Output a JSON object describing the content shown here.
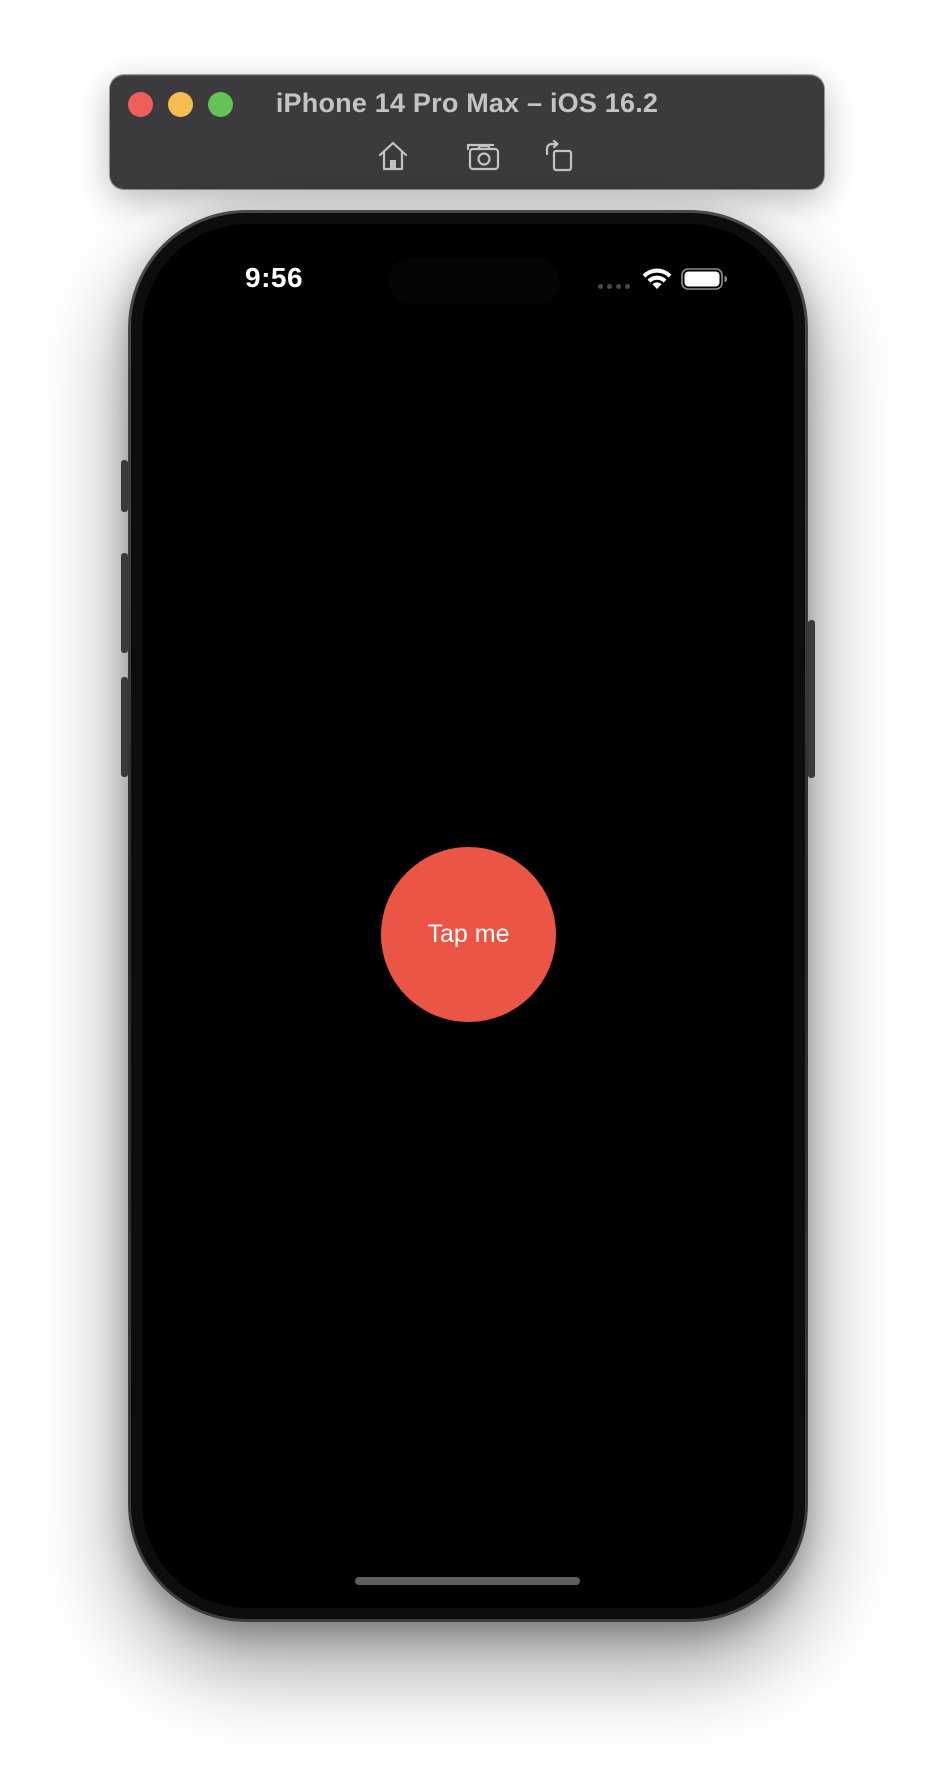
{
  "simulator": {
    "title": "iPhone 14 Pro Max – iOS 16.2",
    "traffic_lights": {
      "close_color": "#ee5f57",
      "minimize_color": "#f5bd4f",
      "zoom_color": "#61c454"
    },
    "toolbar_icons": [
      "home-icon",
      "screenshot-icon",
      "rotate-icon"
    ]
  },
  "status_bar": {
    "time": "9:56",
    "icons": [
      "cellular-signal-icon",
      "wifi-icon",
      "battery-icon"
    ]
  },
  "main": {
    "button_label": "Tap me",
    "button_color": "#eb5545",
    "background_color": "#000000"
  }
}
